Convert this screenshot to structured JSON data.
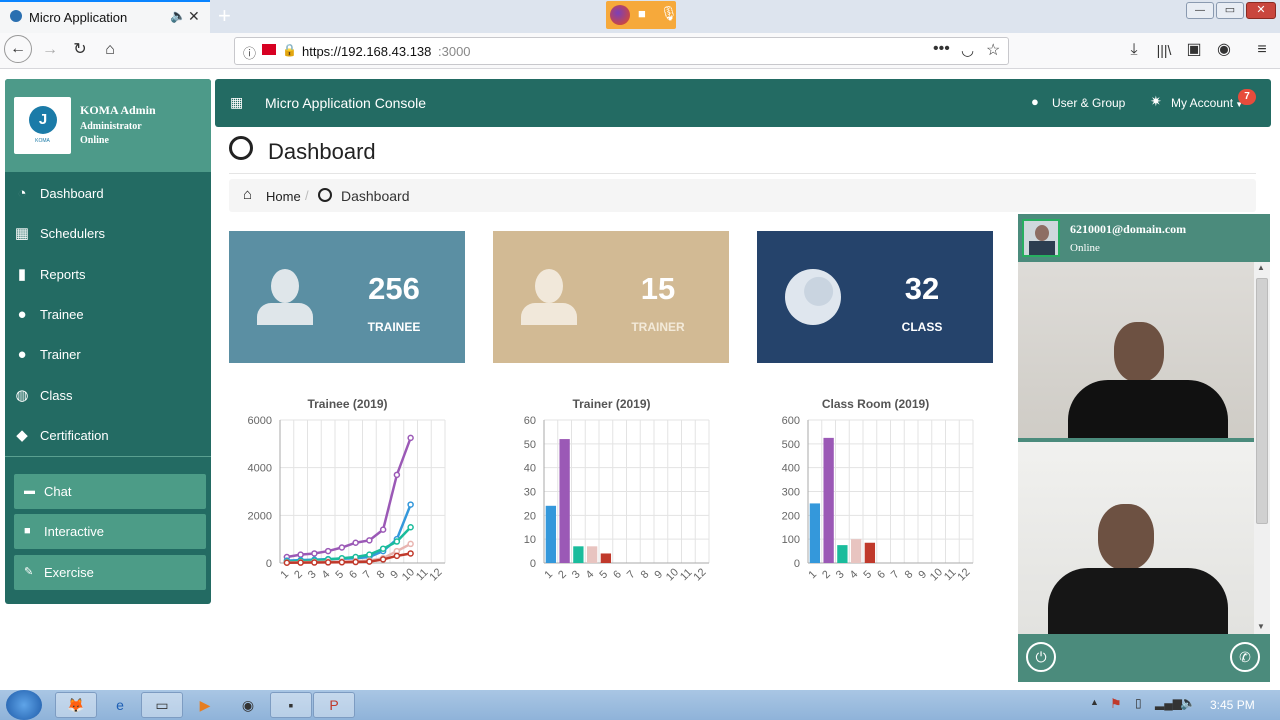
{
  "browser": {
    "tab_title": "Micro Application",
    "new_tab": "+",
    "url_host": "https://192.168.43.138",
    "url_port": ":3000",
    "window_min": "—",
    "window_max": "▭",
    "window_close": "✕"
  },
  "sidebar": {
    "profile_name": "KOMA Admin",
    "profile_role": "Administrator",
    "profile_status": "Online",
    "logo_text": "KOMA",
    "items": [
      {
        "label": "Dashboard",
        "icon": "dashboard-icon"
      },
      {
        "label": "Schedulers",
        "icon": "calendar-icon"
      },
      {
        "label": "Reports",
        "icon": "bar-chart-icon"
      },
      {
        "label": "Trainee",
        "icon": "user-icon"
      },
      {
        "label": "Trainer",
        "icon": "user-icon"
      },
      {
        "label": "Class",
        "icon": "globe-icon"
      },
      {
        "label": "Certification",
        "icon": "tags-icon"
      }
    ],
    "buttons": [
      {
        "label": "Chat",
        "icon": "chat-icon"
      },
      {
        "label": "Interactive",
        "icon": "video-icon"
      },
      {
        "label": "Exercise",
        "icon": "exercise-icon"
      }
    ]
  },
  "appbar": {
    "title": "Micro Application Console",
    "user_group": "User & Group",
    "my_account": "My Account",
    "badge": "7"
  },
  "page": {
    "title": "Dashboard",
    "breadcrumb_home": "Home",
    "breadcrumb_current": "Dashboard"
  },
  "cards": [
    {
      "value": "256",
      "label": "TRAINEE",
      "color": "#5b8fa3"
    },
    {
      "value": "15",
      "label": "TRAINER",
      "color": "#d2ba94"
    },
    {
      "value": "32",
      "label": "CLASS",
      "color": "#25436b"
    }
  ],
  "chart_data": [
    {
      "type": "line",
      "title": "Trainee (2019)",
      "x": [
        "1",
        "2",
        "3",
        "4",
        "5",
        "6",
        "7",
        "8",
        "9",
        "10",
        "11",
        "12"
      ],
      "ylim": [
        0,
        6000
      ],
      "yticks": [
        "0",
        "2000",
        "4000",
        "6000"
      ],
      "series": [
        {
          "color": "#9b59b6",
          "values": [
            250,
            350,
            400,
            500,
            650,
            850,
            950,
            1400,
            3700,
            5250,
            null,
            null
          ]
        },
        {
          "color": "#3498db",
          "values": [
            100,
            120,
            140,
            160,
            180,
            200,
            250,
            500,
            1000,
            2450,
            null,
            null
          ]
        },
        {
          "color": "#1abc9c",
          "values": [
            50,
            80,
            100,
            150,
            200,
            250,
            350,
            600,
            900,
            1500,
            null,
            null
          ]
        },
        {
          "color": "#e8b4b0",
          "values": [
            20,
            30,
            40,
            50,
            60,
            80,
            100,
            200,
            500,
            800,
            null,
            null
          ]
        },
        {
          "color": "#c0392b",
          "values": [
            10,
            15,
            20,
            25,
            30,
            40,
            60,
            150,
            300,
            400,
            null,
            null
          ]
        }
      ]
    },
    {
      "type": "bar",
      "title": "Trainer (2019)",
      "categories": [
        "1",
        "2",
        "3",
        "4",
        "5",
        "6",
        "7",
        "8",
        "9",
        "10",
        "11",
        "12"
      ],
      "ylim": [
        0,
        60
      ],
      "yticks": [
        "0",
        "10",
        "20",
        "30",
        "40",
        "50",
        "60"
      ],
      "values": [
        24,
        52,
        7,
        7,
        4,
        0,
        0,
        0,
        0,
        0,
        0,
        0
      ],
      "colors": [
        "#3498db",
        "#9b59b6",
        "#1abc9c",
        "#e8c4c0",
        "#c0392b"
      ]
    },
    {
      "type": "bar",
      "title": "Class Room (2019)",
      "categories": [
        "1",
        "2",
        "3",
        "4",
        "5",
        "6",
        "7",
        "8",
        "9",
        "10",
        "11",
        "12"
      ],
      "ylim": [
        0,
        600
      ],
      "yticks": [
        "0",
        "100",
        "200",
        "300",
        "400",
        "500",
        "600"
      ],
      "values": [
        250,
        525,
        75,
        100,
        85,
        0,
        0,
        0,
        0,
        0,
        0,
        0
      ],
      "colors": [
        "#3498db",
        "#9b59b6",
        "#1abc9c",
        "#e8c4c0",
        "#c0392b"
      ]
    }
  ],
  "video": {
    "user": "6210001@domain.com",
    "status": "Online"
  },
  "taskbar": {
    "time": "3:45 PM"
  }
}
